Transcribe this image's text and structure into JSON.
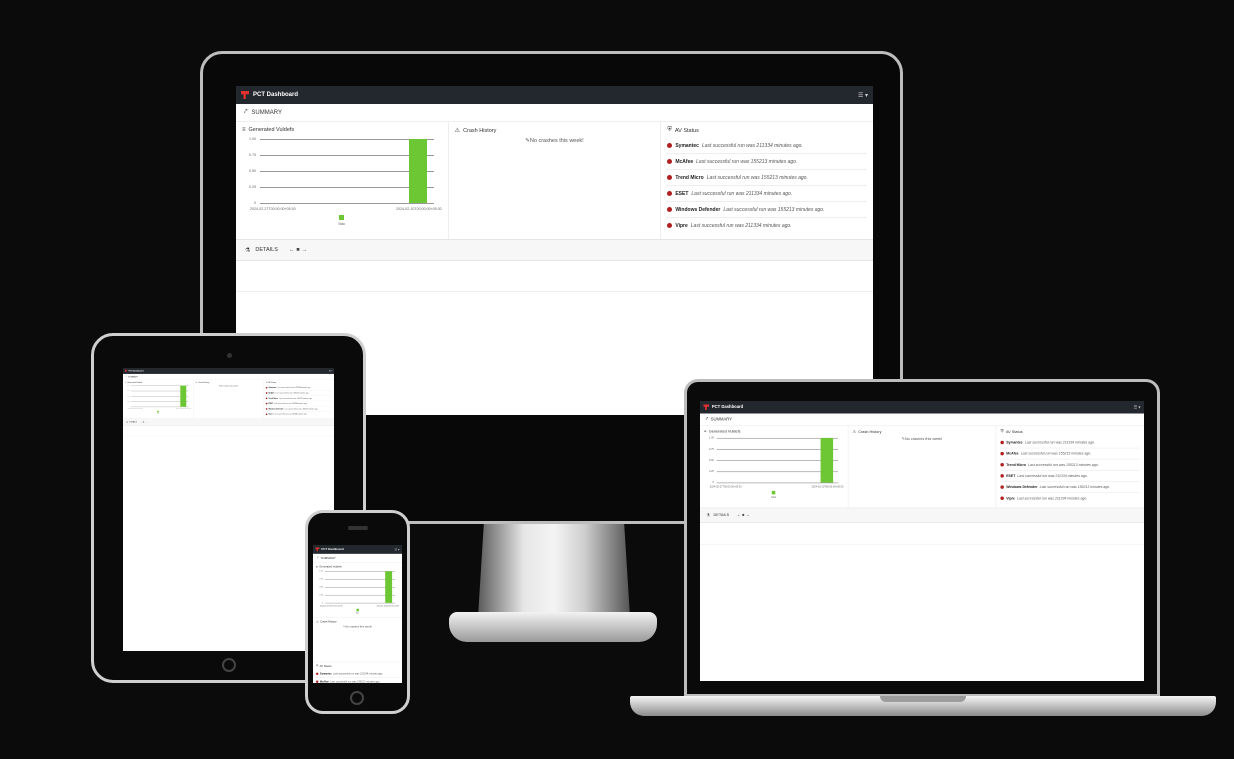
{
  "app": {
    "title": "PCT Dashboard",
    "menu_icon": "menu-icon",
    "brand_color": "#e03131"
  },
  "summary": {
    "label": "SUMMARY",
    "icon": "trend-icon"
  },
  "vulndefs": {
    "title": "Generated Vuldefs",
    "icon": "document-icon"
  },
  "chart_data": {
    "type": "bar",
    "title": "Generated Vuldefs",
    "x_tick_labels": [
      "2024-02-27T00:00:00+05:30",
      "2024-02-10T00:00:00+05:30"
    ],
    "y_ticks": [
      "1.00",
      "0.75",
      "0.50",
      "0.25",
      "0"
    ],
    "ylim": [
      0,
      1
    ],
    "series": [
      {
        "name": "Mac",
        "values": [
          1.0
        ],
        "color": "#6dc734"
      }
    ],
    "legend": "bottom",
    "grid": true
  },
  "crash_history": {
    "title": "Crash History",
    "icon": "warning-icon",
    "message": "No crashes this week!"
  },
  "av_status": {
    "title": "AV Status",
    "icon": "shield-icon",
    "status_color": "#b11f1f",
    "items": [
      {
        "name": "Symantec",
        "message": "Last successful run was 211334 minutes ago."
      },
      {
        "name": "McAfee",
        "message": "Last successful run was 155213 minutes ago."
      },
      {
        "name": "Trend Micro",
        "message": "Last successful run was 155213 minutes ago."
      },
      {
        "name": "ESET",
        "message": "Last successful run was 211334 minutes ago."
      },
      {
        "name": "Windows Defender",
        "message": "Last successful run was 155213 minutes ago."
      },
      {
        "name": "Vipre",
        "message": "Last successful run was 211334 minutes ago."
      }
    ]
  },
  "details": {
    "label": "DETAILS",
    "icon": "microscope-icon",
    "pager": [
      "←",
      "■",
      "→"
    ]
  }
}
